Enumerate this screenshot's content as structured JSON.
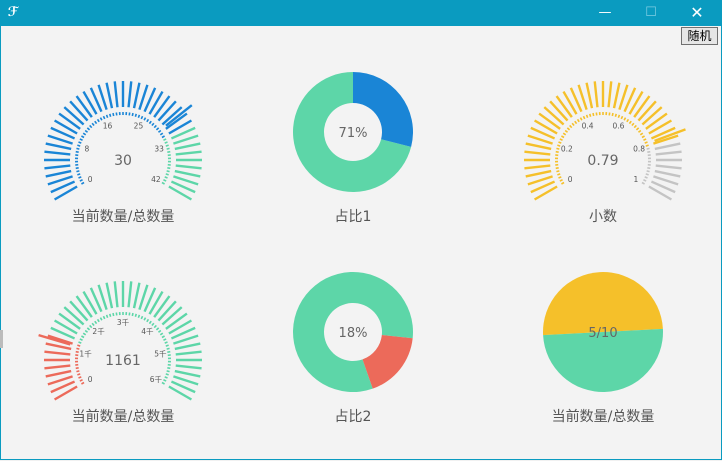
{
  "window": {
    "app_icon": "ℱ",
    "min_glyph": "—",
    "max_glyph": "☐",
    "close_glyph": "✕"
  },
  "toolbar": {
    "random_label": "随机"
  },
  "gauges": [
    {
      "id": "g1",
      "value": 30,
      "min": 0,
      "max": 42,
      "display": "30",
      "tick_labels": [
        "0",
        "8",
        "16",
        "25",
        "33",
        "42"
      ],
      "caption": "当前数量/总数量",
      "zones": [
        {
          "from": 0,
          "to": 0.75,
          "color": "#1a85d6"
        },
        {
          "from": 0.75,
          "to": 1,
          "color": "#5dd6a8"
        }
      ],
      "pointer_color": "#1a85d6"
    },
    {
      "id": "g2",
      "value": 0.79,
      "min": 0,
      "max": 1,
      "display": "0.79",
      "tick_labels": [
        "0",
        "0.2",
        "0.4",
        "0.6",
        "0.8",
        "1"
      ],
      "caption": "小数",
      "zones": [
        {
          "from": 0,
          "to": 0.8,
          "color": "#f5c02a"
        },
        {
          "from": 0.8,
          "to": 1,
          "color": "#c4c4c4"
        }
      ],
      "pointer_color": "#f5c02a"
    },
    {
      "id": "g3",
      "value": 1161,
      "min": 0,
      "max": 6000,
      "display": "1161",
      "tick_labels": [
        "0",
        "1千",
        "2千",
        "3千",
        "4千",
        "5千",
        "6千"
      ],
      "caption": "当前数量/总数量",
      "zones": [
        {
          "from": 0,
          "to": 0.2,
          "color": "#ec6a5a"
        },
        {
          "from": 0.2,
          "to": 1,
          "color": "#5dd6a8"
        }
      ],
      "pointer_color": "#ec6a5a"
    }
  ],
  "donuts": [
    {
      "id": "d1",
      "percent": 71,
      "display": "71%",
      "caption": "占比1",
      "main_color": "#5dd6a8",
      "rest_color": "#1a85d6"
    },
    {
      "id": "d2",
      "percent": 18,
      "display": "18%",
      "caption": "占比2",
      "main_color": "#ec6a5a",
      "rest_color": "#5dd6a8"
    }
  ],
  "pie": {
    "value": 5,
    "total": 10,
    "display": "5/10",
    "caption": "当前数量/总数量",
    "value_color": "#5dd6a8",
    "rest_color": "#f5c02a"
  },
  "chart_data": [
    {
      "type": "gauge",
      "value": 30,
      "min": 0,
      "max": 42,
      "ticks": [
        "0",
        "8",
        "16",
        "25",
        "33",
        "42"
      ],
      "label": "当前数量/总数量"
    },
    {
      "type": "pie",
      "variant": "donut",
      "values": [
        71,
        29
      ],
      "label": "占比1",
      "center_text": "71%"
    },
    {
      "type": "gauge",
      "value": 0.79,
      "min": 0,
      "max": 1,
      "ticks": [
        "0",
        "0.2",
        "0.4",
        "0.6",
        "0.8",
        "1"
      ],
      "label": "小数"
    },
    {
      "type": "gauge",
      "value": 1161,
      "min": 0,
      "max": 6000,
      "ticks": [
        "0",
        "1千",
        "2千",
        "3千",
        "4千",
        "5千",
        "6千"
      ],
      "label": "当前数量/总数量"
    },
    {
      "type": "pie",
      "variant": "donut",
      "values": [
        18,
        82
      ],
      "label": "占比2",
      "center_text": "18%"
    },
    {
      "type": "pie",
      "values": [
        5,
        5
      ],
      "label": "当前数量/总数量",
      "center_text": "5/10"
    }
  ]
}
